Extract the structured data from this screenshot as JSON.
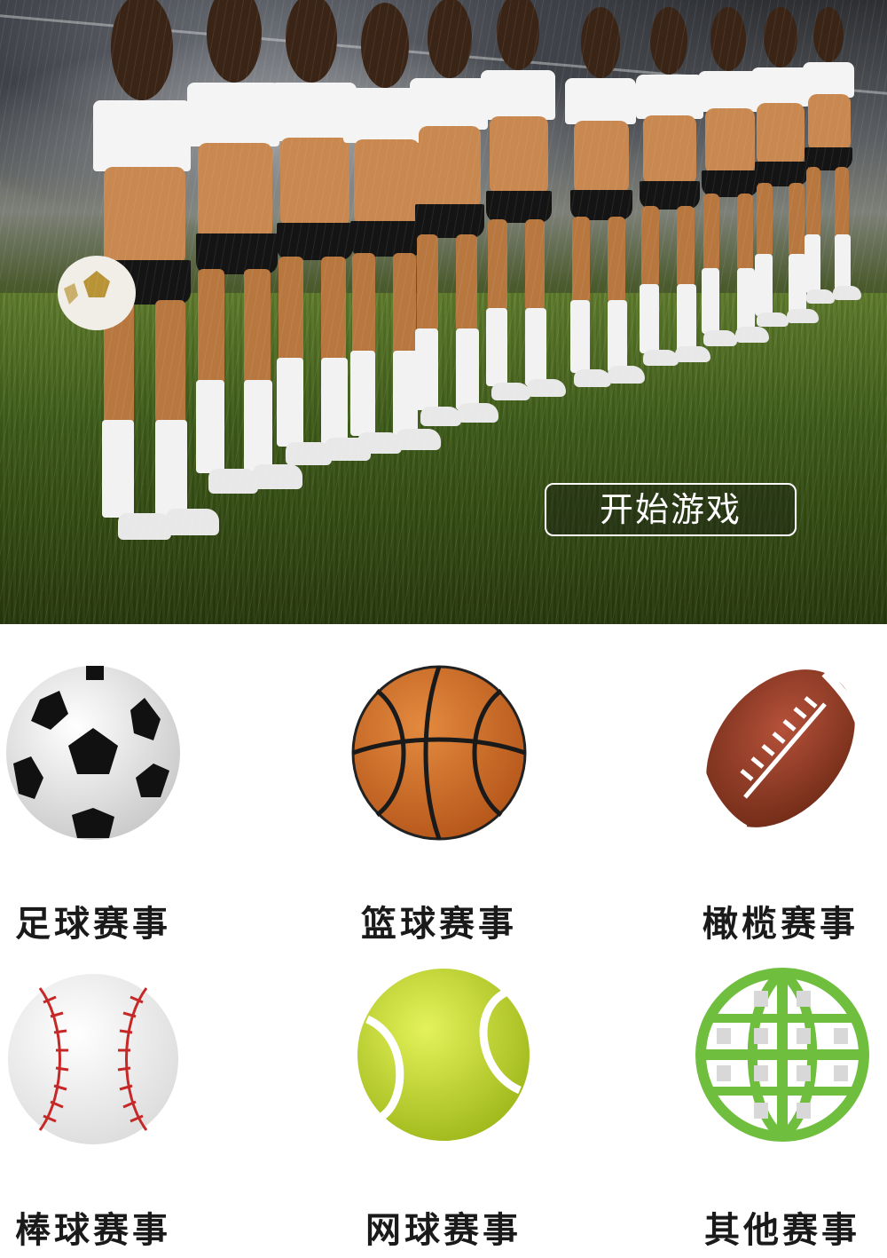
{
  "hero": {
    "start_button_label": "开始游戏"
  },
  "sports": [
    {
      "label": "足球赛事",
      "icon": "soccer-ball-icon"
    },
    {
      "label": "篮球赛事",
      "icon": "basketball-icon"
    },
    {
      "label": "橄榄赛事",
      "icon": "rugby-ball-icon"
    },
    {
      "label": "棒球赛事",
      "icon": "baseball-icon"
    },
    {
      "label": "网球赛事",
      "icon": "tennis-ball-icon"
    },
    {
      "label": "其他赛事",
      "icon": "globe-icon"
    }
  ],
  "colors": {
    "basketball": "#c8651f",
    "rugby": "#8a3a1e",
    "tennis": "#c6dc2a",
    "globe": "#6fbe3e",
    "baseball_stitch": "#c62828"
  }
}
